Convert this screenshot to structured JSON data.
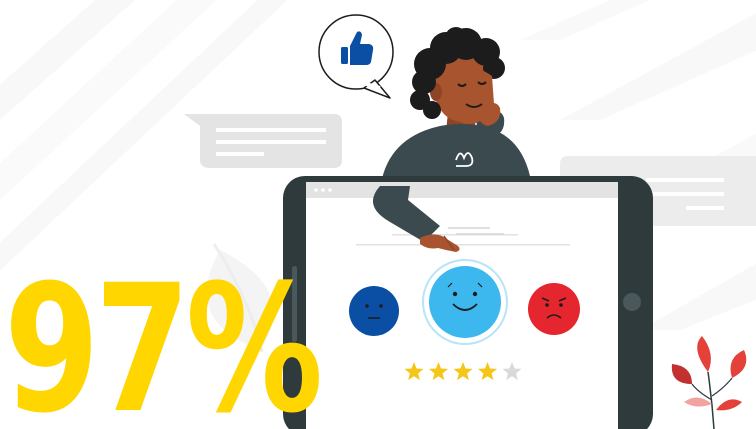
{
  "headline": {
    "stat": "97%"
  },
  "rating": {
    "stars_filled": 4,
    "stars_total": 5
  },
  "icons": {
    "thumb": "thumbs-up-icon",
    "happy": "happy-face-icon",
    "neutral": "neutral-face-icon",
    "sad": "sad-face-icon",
    "star": "star-icon"
  },
  "colors": {
    "stat_yellow": "#ffd600",
    "brand_blue": "#0a4fa3",
    "happy_cyan": "#3db8ef",
    "sad_red": "#e5262e",
    "star_gold": "#f5c518",
    "star_empty": "#d9d9d9",
    "tablet_frame": "#2f3a3d",
    "skin": "#a8552f",
    "hair": "#1c1c1c",
    "sweater": "#3b4a4f"
  }
}
